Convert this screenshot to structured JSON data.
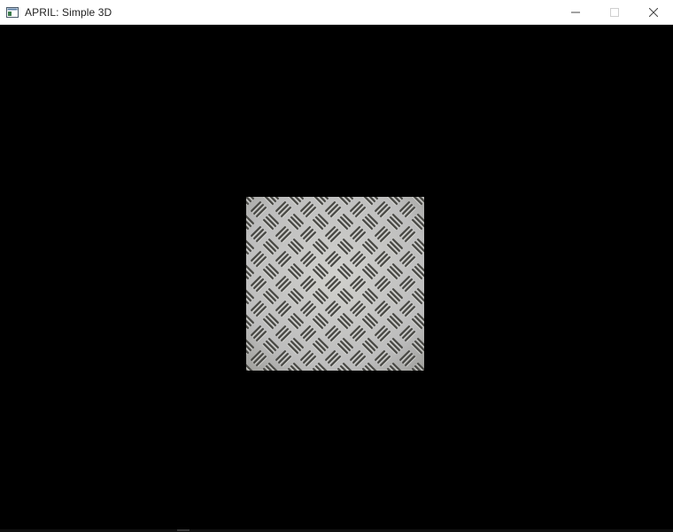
{
  "window": {
    "title": "APRIL: Simple 3D",
    "app_icon": "application-window-icon",
    "controls": {
      "minimize_icon": "minimize-icon",
      "maximize_icon": "maximize-icon",
      "close_icon": "close-icon"
    }
  },
  "scene": {
    "background_color": "#000000",
    "object": "textured-quad",
    "texture": "diamond-plate-metal"
  },
  "colors": {
    "titlebar": "#ffffff",
    "title_text": "#222222",
    "plate_base": "#bdbdbd",
    "plate_groove": "#4a4a46"
  }
}
